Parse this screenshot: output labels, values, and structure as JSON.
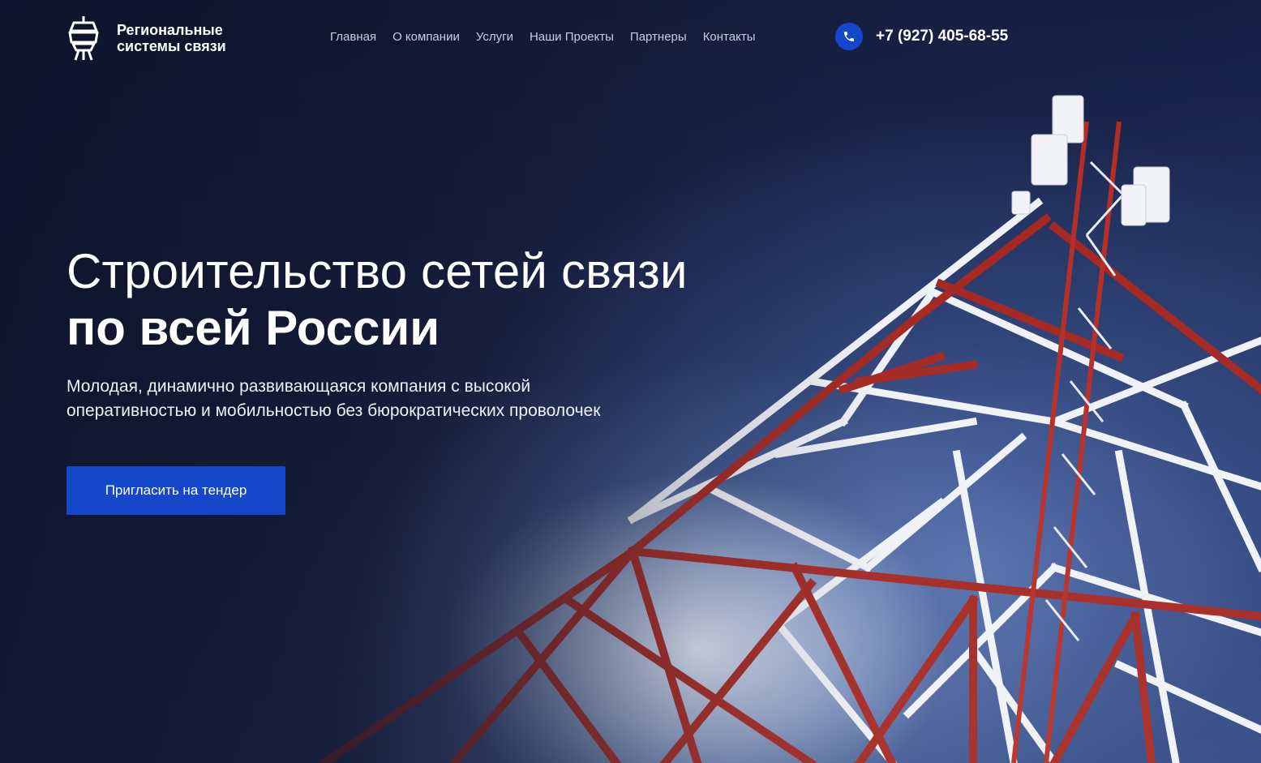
{
  "brand": {
    "name_line1": "Региональные",
    "name_line2": "системы связи",
    "logo_icon": "tower-logo-icon"
  },
  "nav": {
    "items": [
      "Главная",
      "О компании",
      "Услуги",
      "Наши Проекты",
      "Партнеры",
      "Контакты"
    ]
  },
  "contact": {
    "phone": "+7 (927) 405-68-55",
    "phone_icon": "phone-icon"
  },
  "hero": {
    "title_line1": "Строительство сетей связи",
    "title_line2": "по всей России",
    "subtitle_line1": "Молодая, динамично развивающаяся компания с высокой",
    "subtitle_line2": "оперативностью и мобильностью без бюрократических проволочек",
    "cta_label": "Пригласить на тендер",
    "image": "telecom-tower-photo"
  },
  "colors": {
    "background": "#141b35",
    "accent": "#1447c9",
    "tower_red": "#a3231c",
    "tower_white": "#f2f4f8"
  }
}
